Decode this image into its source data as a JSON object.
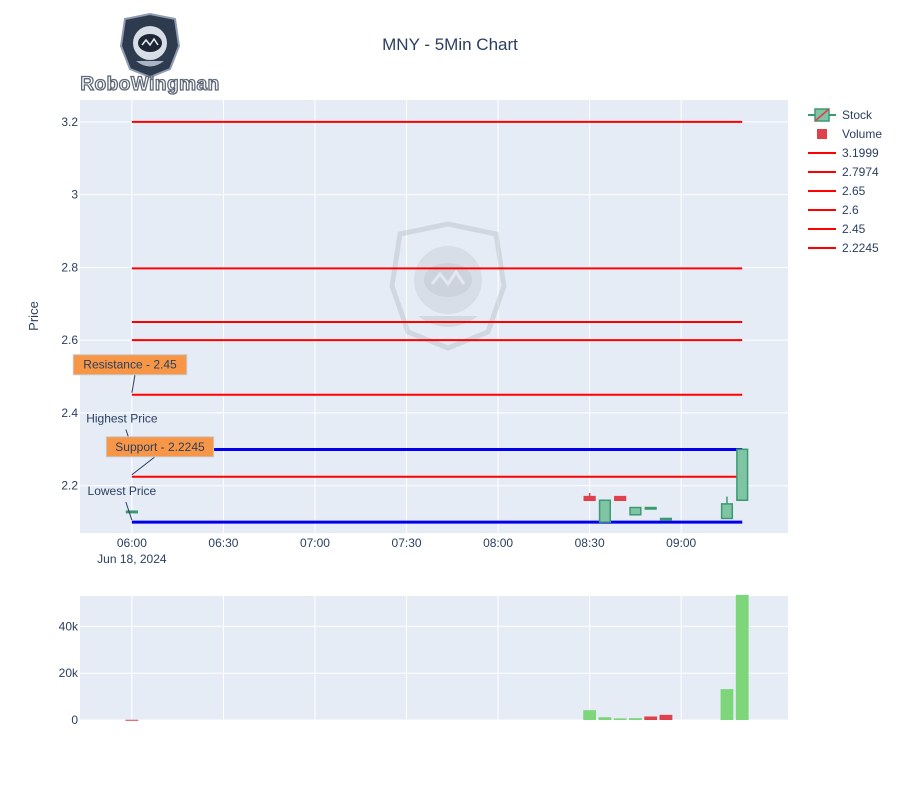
{
  "chart_data": {
    "type": "candlestick",
    "title": "MNY - 5Min Chart",
    "brand": "RoboWingman",
    "colors": {
      "increasing": "#3d9970",
      "increasing_fill": "#7fc4a4",
      "decreasing": "#e0404a",
      "level_line": "#ff0000",
      "extreme_line": "#0000ee",
      "annotation_fill": "#f79646",
      "plot_bg": "#e5ecf6"
    },
    "price_panel": {
      "ylabel": "Price",
      "ylim": [
        2.07,
        3.26
      ],
      "yticks": [
        2.2,
        2.4,
        2.6,
        2.8,
        3.0,
        3.2
      ],
      "ytick_labels": [
        "2.2",
        "2.4",
        "2.6",
        "2.8",
        "3",
        "3.2"
      ]
    },
    "x_axis": {
      "range": [
        "05:43",
        "09:35"
      ],
      "ticks": [
        "06:00",
        "06:30",
        "07:00",
        "07:30",
        "08:00",
        "08:30",
        "09:00"
      ],
      "tick_labels": [
        "06:00",
        "06:30",
        "07:00",
        "07:30",
        "08:00",
        "08:30",
        "09:00"
      ],
      "date_label": "Jun 18, 2024"
    },
    "candles": [
      {
        "t": "06:00",
        "o": 2.13,
        "h": 2.13,
        "l": 2.13,
        "c": 2.13
      },
      {
        "t": "08:30",
        "o": 2.17,
        "h": 2.18,
        "l": 2.16,
        "c": 2.16
      },
      {
        "t": "08:35",
        "o": 2.1,
        "h": 2.16,
        "l": 2.1,
        "c": 2.16
      },
      {
        "t": "08:40",
        "o": 2.17,
        "h": 2.17,
        "l": 2.16,
        "c": 2.16
      },
      {
        "t": "08:45",
        "o": 2.12,
        "h": 2.14,
        "l": 2.12,
        "c": 2.14
      },
      {
        "t": "08:50",
        "o": 2.14,
        "h": 2.14,
        "l": 2.14,
        "c": 2.14
      },
      {
        "t": "08:55",
        "o": 2.11,
        "h": 2.11,
        "l": 2.11,
        "c": 2.11
      },
      {
        "t": "09:15",
        "o": 2.11,
        "h": 2.17,
        "l": 2.11,
        "c": 2.15
      },
      {
        "t": "09:20",
        "o": 2.16,
        "h": 2.3,
        "l": 2.16,
        "c": 2.3
      }
    ],
    "volume_panel": {
      "ylim": [
        0,
        53000
      ],
      "yticks": [
        0,
        20000,
        40000
      ],
      "ytick_labels": [
        "0",
        "20k",
        "40k"
      ],
      "bars": [
        {
          "t": "06:00",
          "v": 100,
          "dir": "down"
        },
        {
          "t": "08:30",
          "v": 4200,
          "dir": "up"
        },
        {
          "t": "08:35",
          "v": 1200,
          "dir": "up"
        },
        {
          "t": "08:40",
          "v": 700,
          "dir": "up"
        },
        {
          "t": "08:45",
          "v": 800,
          "dir": "up"
        },
        {
          "t": "08:50",
          "v": 1500,
          "dir": "down"
        },
        {
          "t": "08:55",
          "v": 2200,
          "dir": "down"
        },
        {
          "t": "09:15",
          "v": 13200,
          "dir": "up"
        },
        {
          "t": "09:20",
          "v": 53500,
          "dir": "up"
        }
      ]
    },
    "levels": [
      {
        "value": 3.1999,
        "label": "3.1999"
      },
      {
        "value": 2.7974,
        "label": "2.7974"
      },
      {
        "value": 2.65,
        "label": "2.65"
      },
      {
        "value": 2.6,
        "label": "2.6"
      },
      {
        "value": 2.45,
        "label": "2.45"
      },
      {
        "value": 2.2245,
        "label": "2.2245"
      }
    ],
    "level_start": "06:00",
    "level_end": "09:20",
    "extremes": [
      {
        "value": 2.2995,
        "label": "Highest Price"
      },
      {
        "value": 2.1,
        "label": "Lowest Price"
      }
    ],
    "annotations": [
      {
        "text": "Resistance - 2.45",
        "value": 2.45
      },
      {
        "text": "Support - 2.2245",
        "value": 2.2245
      }
    ],
    "legend": {
      "position": "right",
      "entries": [
        "Stock",
        "Volume",
        "3.1999",
        "2.7974",
        "2.65",
        "2.6",
        "2.45",
        "2.2245"
      ]
    }
  }
}
